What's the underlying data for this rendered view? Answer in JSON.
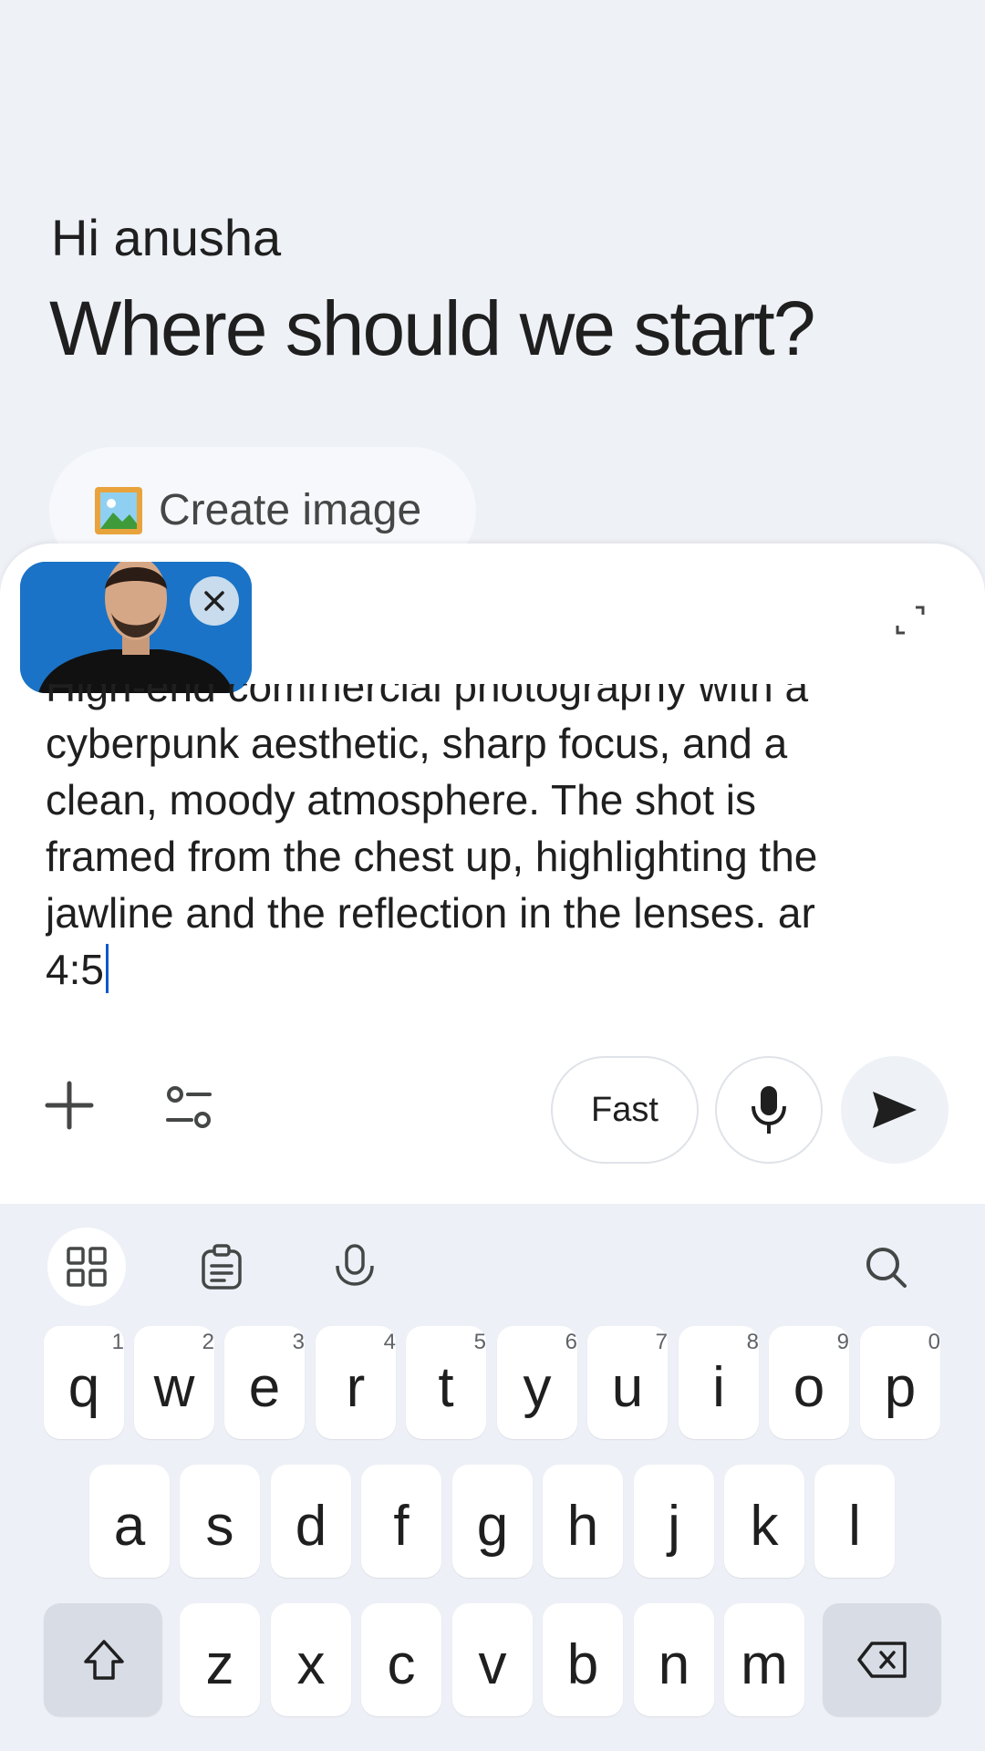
{
  "greeting": "Hi anusha",
  "headline": "Where should we start?",
  "chip": {
    "label": "Create image",
    "icon": "picture-icon"
  },
  "prompt": {
    "text": "High-end commercial photography with a cyberpunk aesthetic, sharp focus, and a clean, moody atmosphere. The shot is framed from the chest up, highlighting the jawline and the reflection in the lenses. ar 4:5"
  },
  "toolbar": {
    "mode_label": "Fast",
    "icons": [
      "plus-icon",
      "tools-icon",
      "mic-icon",
      "send-icon"
    ]
  },
  "keyboard": {
    "tools": [
      "apps-grid-icon",
      "clipboard-icon",
      "voice-icon",
      "search-icon"
    ],
    "row1": [
      {
        "key": "q",
        "hint": "1"
      },
      {
        "key": "w",
        "hint": "2"
      },
      {
        "key": "e",
        "hint": "3"
      },
      {
        "key": "r",
        "hint": "4"
      },
      {
        "key": "t",
        "hint": "5"
      },
      {
        "key": "y",
        "hint": "6"
      },
      {
        "key": "u",
        "hint": "7"
      },
      {
        "key": "i",
        "hint": "8"
      },
      {
        "key": "o",
        "hint": "9"
      },
      {
        "key": "p",
        "hint": "0"
      }
    ],
    "row2": [
      "a",
      "s",
      "d",
      "f",
      "g",
      "h",
      "j",
      "k",
      "l"
    ],
    "row3": [
      "z",
      "x",
      "c",
      "v",
      "b",
      "n",
      "m"
    ],
    "special": [
      "shift-icon",
      "backspace-icon"
    ]
  },
  "colors": {
    "accent": "#0b57d0",
    "thumbnail_bg": "#1a73c6"
  }
}
